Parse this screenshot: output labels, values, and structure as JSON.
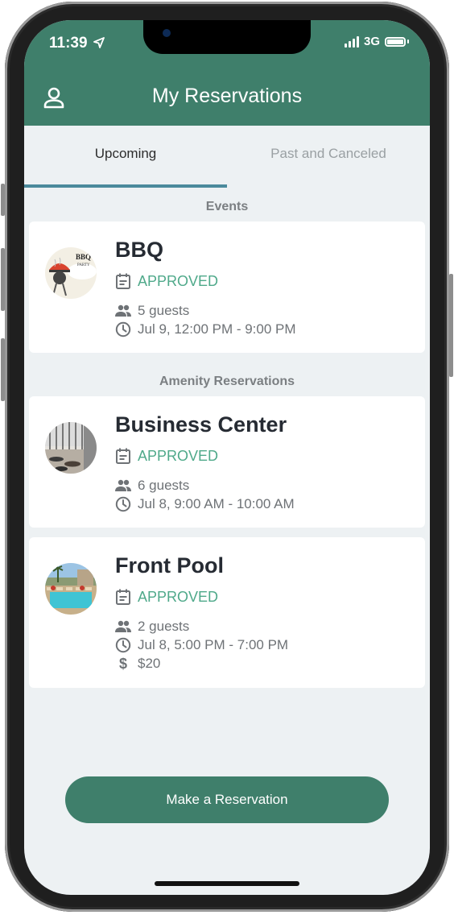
{
  "status_bar": {
    "time": "11:39",
    "network": "3G"
  },
  "header": {
    "title": "My Reservations",
    "profile_icon": "person-icon"
  },
  "tabs": [
    {
      "label": "Upcoming",
      "active": true
    },
    {
      "label": "Past and Canceled",
      "active": false
    }
  ],
  "sections": {
    "events": "Events",
    "amenities": "Amenity Reservations"
  },
  "reservations": [
    {
      "title": "BBQ",
      "status": "APPROVED",
      "guests": "5 guests",
      "time": "Jul 9, 12:00 PM - 9:00 PM",
      "image_text": "BBQ",
      "image_subtext": "PARTY"
    },
    {
      "title": "Business Center",
      "status": "APPROVED",
      "guests": "6 guests",
      "time": "Jul 8, 9:00 AM - 10:00 AM"
    },
    {
      "title": "Front Pool",
      "status": "APPROVED",
      "guests": "2 guests",
      "time": "Jul 8, 5:00 PM - 7:00 PM",
      "price": "$20"
    }
  ],
  "cta": {
    "label": "Make a Reservation"
  },
  "colors": {
    "brand": "#3f7f6b",
    "approved": "#4fa98a",
    "tab_indicator": "#4b8a9c",
    "background": "#edf1f3"
  }
}
